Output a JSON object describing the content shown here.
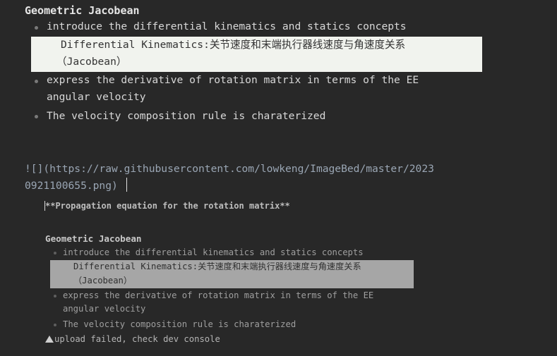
{
  "top": {
    "title": "Geometric Jacobean",
    "items": [
      "introduce the differential kinematics and statics concepts",
      "express the derivative of rotation matrix in terms of the EE",
      "angular velocity",
      "The velocity composition rule is charaterized"
    ],
    "highlight_line1": "Differential Kinematics:关节速度和末端执行器线速度与角速度关系",
    "highlight_line2": "（Jacobean）"
  },
  "image_markdown": {
    "line1": "![](https://raw.githubusercontent.com/lowkeng/ImageBed/master/2023",
    "line2": "0921100655.png)"
  },
  "preview": {
    "bold_heading": "**Propagation equation for the rotation matrix**",
    "title": "Geometric Jacobean",
    "items": [
      "introduce the differential kinematics and statics concepts",
      "express the derivative of rotation matrix in terms of the EE",
      "angular velocity",
      "The velocity composition rule is charaterized"
    ],
    "highlight_line1": "Differential Kinematics:关节速度和末端执行器线速度与角速度关系",
    "highlight_line2": "（Jacobean）",
    "upload_status": "upload failed, check dev console"
  },
  "icons": {
    "warning": "warning-triangle-icon"
  }
}
